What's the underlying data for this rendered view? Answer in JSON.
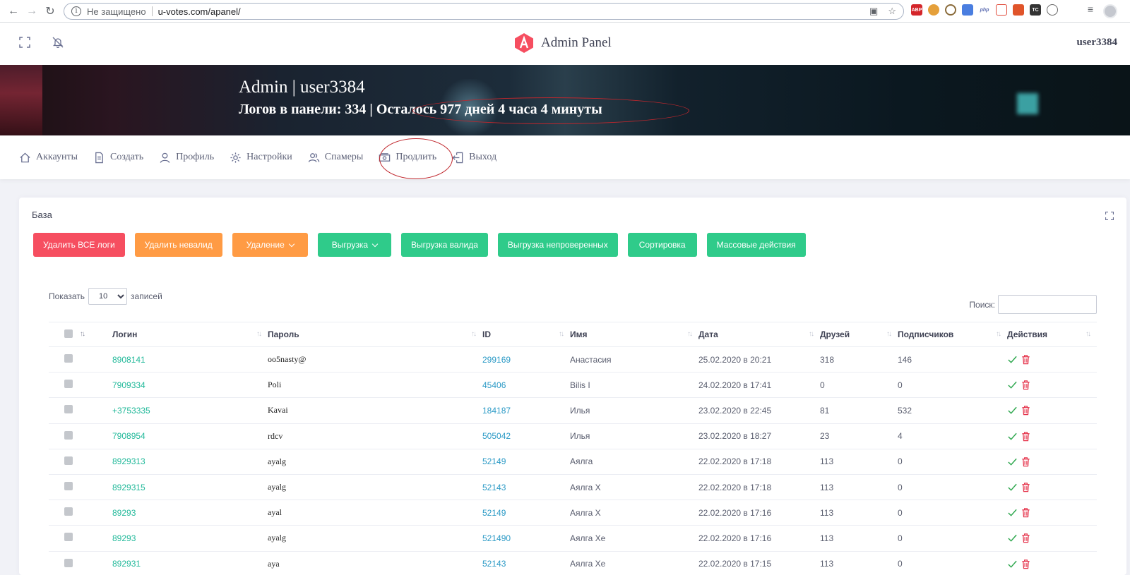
{
  "browser": {
    "security_label": "Не защищено",
    "url": "u-votes.com/apanel/"
  },
  "header": {
    "brand_title": "Admin Panel",
    "username": "user3384"
  },
  "banner": {
    "title": "Admin | user3384",
    "subtitle": "Логов в панели: 334 | Осталось 977 дней 4 часа 4 минуты"
  },
  "menu": {
    "items": [
      {
        "label": "Аккаунты",
        "icon": "home-icon"
      },
      {
        "label": "Создать",
        "icon": "document-icon"
      },
      {
        "label": "Профиль",
        "icon": "user-icon"
      },
      {
        "label": "Настройки",
        "icon": "gear-icon"
      },
      {
        "label": "Спамеры",
        "icon": "users-icon"
      },
      {
        "label": "Продлить",
        "icon": "money-icon"
      },
      {
        "label": "Выход",
        "icon": "logout-icon"
      }
    ]
  },
  "card": {
    "title": "База",
    "buttons": {
      "delete_all": "Удалить ВСЕ логи",
      "delete_invalid": "Удалить невалид",
      "deletion": "Удаление",
      "export": "Выгрузка",
      "export_valid": "Выгрузка валида",
      "export_unchecked": "Выгрузка непроверенных",
      "sort": "Сортировка",
      "bulk": "Массовые действия"
    },
    "length": {
      "prefix": "Показать",
      "value": "10",
      "suffix": "записей"
    },
    "search_label": "Поиск:"
  },
  "table": {
    "columns": {
      "login": "Логин",
      "password": "Пароль",
      "id": "ID",
      "name": "Имя",
      "date": "Дата",
      "friends": "Друзей",
      "followers": "Подписчиков",
      "actions": "Действия"
    },
    "rows": [
      {
        "login": "8908141",
        "password": "oo5nasty@",
        "id": "299169",
        "name": "Анастасия",
        "date": "25.02.2020 в 20:21",
        "friends": "318",
        "followers": "146"
      },
      {
        "login": "7909334",
        "password": "Poli",
        "id": "45406",
        "name": "Bilis I",
        "date": "24.02.2020 в 17:41",
        "friends": "0",
        "followers": "0"
      },
      {
        "login": "+3753335",
        "password": "Kavai",
        "id": "184187",
        "name": "Илья",
        "date": "23.02.2020 в 22:45",
        "friends": "81",
        "followers": "532"
      },
      {
        "login": "7908954",
        "password": "rdcv",
        "id": "505042",
        "name": "Илья",
        "date": "23.02.2020 в 18:27",
        "friends": "23",
        "followers": "4"
      },
      {
        "login": "8929313",
        "password": "ayalg",
        "id": "52149",
        "name": "Аялга",
        "date": "22.02.2020 в 17:18",
        "friends": "113",
        "followers": "0"
      },
      {
        "login": "8929315",
        "password": "ayalg",
        "id": "52143",
        "name": "Аялга Х",
        "date": "22.02.2020 в 17:18",
        "friends": "113",
        "followers": "0"
      },
      {
        "login": "89293",
        "password": "ayal",
        "id": "52149",
        "name": "Аялга Х",
        "date": "22.02.2020 в 17:16",
        "friends": "113",
        "followers": "0"
      },
      {
        "login": "89293",
        "password": "ayalg",
        "id": "521490",
        "name": "Аялга Хе",
        "date": "22.02.2020 в 17:16",
        "friends": "113",
        "followers": "0"
      },
      {
        "login": "892931",
        "password": "aya",
        "id": "52143",
        "name": "Аялга Хе",
        "date": "22.02.2020 в 17:15",
        "friends": "113",
        "followers": "0"
      }
    ]
  },
  "colors": {
    "danger": "#f64e60",
    "warning": "#ff9b44",
    "success": "#2fcb8a",
    "login_link": "#22b99a",
    "id_link": "#2b9ac6",
    "annotation": "#c0272d"
  }
}
